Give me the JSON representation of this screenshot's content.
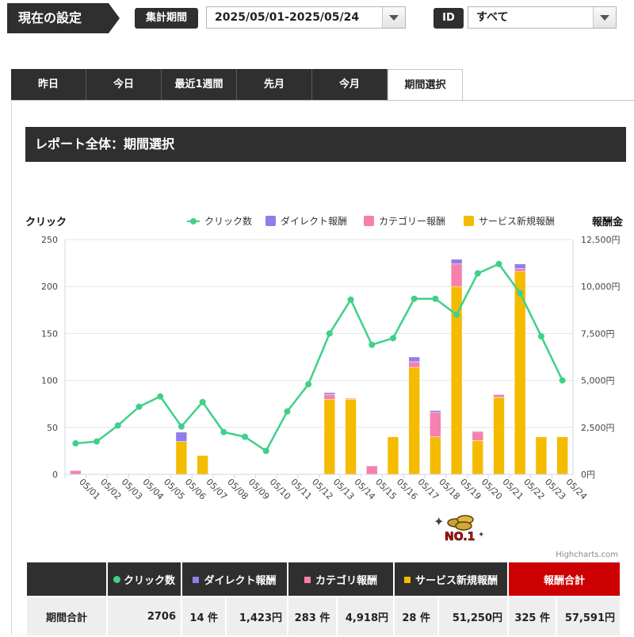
{
  "settings": {
    "title": "現在の設定",
    "period_label": "集計期間",
    "period_value": "2025/05/01-2025/05/24",
    "id_label": "ID",
    "id_value": "すべて"
  },
  "tabs": [
    {
      "label": "昨日",
      "active": false
    },
    {
      "label": "今日",
      "active": false
    },
    {
      "label": "最近1週間",
      "active": false
    },
    {
      "label": "先月",
      "active": false
    },
    {
      "label": "今月",
      "active": false
    },
    {
      "label": "期間選択",
      "active": true
    }
  ],
  "report_title": "レポート全体：期間選択",
  "colors": {
    "clicks": "#3fd08a",
    "direct": "#8f7ee8",
    "category": "#f77fae",
    "service": "#f5bb00",
    "total_header": "#cc0000"
  },
  "chart_data": {
    "type": "bar",
    "left_axis_title": "クリック",
    "right_axis_title": "報酬金",
    "left_ylim": [
      0,
      250
    ],
    "left_ticks": [
      "0",
      "50",
      "100",
      "150",
      "200",
      "250"
    ],
    "right_ylim": [
      0,
      12500
    ],
    "right_ticks": [
      "0円",
      "2,500円",
      "5,000円",
      "7,500円",
      "10,000円",
      "12,500円"
    ],
    "categories": [
      "05/01",
      "05/02",
      "05/03",
      "05/04",
      "05/05",
      "05/06",
      "05/07",
      "05/08",
      "05/09",
      "05/10",
      "05/11",
      "05/12",
      "05/13",
      "05/14",
      "05/15",
      "05/16",
      "05/17",
      "05/18",
      "05/19",
      "05/20",
      "05/21",
      "05/22",
      "05/23",
      "05/24"
    ],
    "series": [
      {
        "name": "クリック数",
        "type": "line",
        "axis": "left",
        "values": [
          33,
          35,
          52,
          72,
          83,
          51,
          77,
          45,
          40,
          25,
          67,
          96,
          150,
          186,
          138,
          145,
          187,
          187,
          170,
          214,
          224,
          193,
          147,
          100
        ]
      },
      {
        "name": "サービス新規報酬",
        "type": "stacked-bar",
        "axis": "right",
        "values": [
          0,
          0,
          0,
          0,
          0,
          1750,
          1000,
          0,
          0,
          0,
          0,
          0,
          4000,
          4000,
          0,
          2000,
          5700,
          2000,
          10000,
          1800,
          4100,
          10800,
          2000,
          2000
        ]
      },
      {
        "name": "カテゴリー報酬",
        "type": "stacked-bar",
        "axis": "right",
        "values": [
          200,
          0,
          0,
          0,
          0,
          0,
          0,
          0,
          0,
          0,
          0,
          0,
          250,
          50,
          450,
          0,
          300,
          1300,
          1200,
          450,
          150,
          150,
          0,
          0
        ]
      },
      {
        "name": "ダイレクト報酬",
        "type": "stacked-bar",
        "axis": "right",
        "values": [
          0,
          0,
          0,
          0,
          0,
          500,
          0,
          0,
          0,
          0,
          0,
          0,
          100,
          0,
          0,
          0,
          250,
          100,
          250,
          50,
          0,
          250,
          0,
          0
        ]
      }
    ],
    "legend": [
      "クリック数",
      "ダイレクト報酬",
      "カテゴリー報酬",
      "サービス新規報酬"
    ],
    "legend_position": "top-right",
    "grid": true,
    "credits": "Highcharts.com"
  },
  "badge_text": "NO.1",
  "table": {
    "headers": {
      "clicks": "クリック数",
      "direct": "ダイレクト報酬",
      "category": "カテゴリ報酬",
      "service": "サービス新規報酬",
      "total": "報酬合計"
    },
    "row": {
      "label": "期間合計",
      "clicks": "2706",
      "direct_count": "14 件",
      "direct_amount": "1,423円",
      "category_count": "283 件",
      "category_amount": "4,918円",
      "service_count": "28 件",
      "service_amount": "51,250円",
      "total_count": "325 件",
      "total_amount": "57,591円"
    }
  }
}
